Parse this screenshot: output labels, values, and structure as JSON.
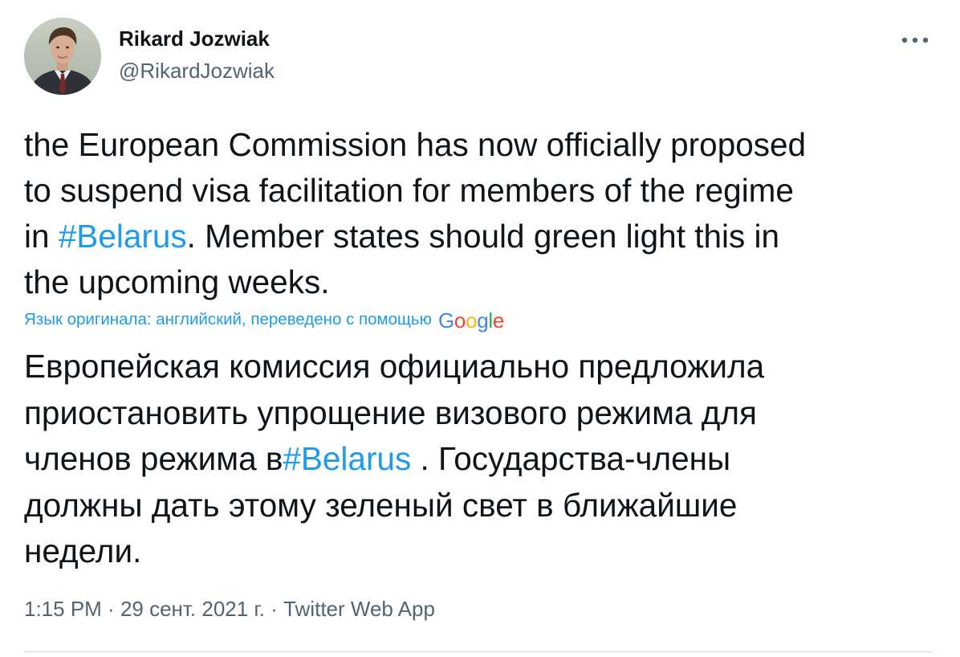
{
  "author": {
    "name": "Rikard Jozwiak",
    "handle": "@RikardJozwiak",
    "avatar_icon": "user-avatar-photo"
  },
  "menu": {
    "more_icon": "more-horizontal-icon"
  },
  "tweet": {
    "lines": [
      {
        "text": "the European Commission has now officially proposed"
      },
      {
        "text": "to suspend visa facilitation for members of the regime"
      },
      {
        "before": "in ",
        "hashtag": "#Belarus",
        "after": ". Member states should green light this in"
      },
      {
        "text": "the upcoming weeks."
      }
    ]
  },
  "translation": {
    "label": "Язык оригинала: английский, переведено с помощью",
    "provider_logo": [
      "G",
      "o",
      "o",
      "g",
      "l",
      "e"
    ],
    "provider_colors": [
      "#4285f4",
      "#ea4335",
      "#fbbc05",
      "#4285f4",
      "#34a853",
      "#ea4335"
    ],
    "lines": [
      {
        "text": "Европейская комиссия официально предложила"
      },
      {
        "text": "приостановить упрощение визового режима для"
      },
      {
        "before": "членов режима в",
        "hashtag": "#Belarus",
        "after": " . Государства-члены"
      },
      {
        "text": "должны дать этому зеленый свет в ближайшие"
      },
      {
        "text": "недели."
      }
    ]
  },
  "meta": {
    "time": "1:15 PM",
    "sep1": " · ",
    "date": "29 сент. 2021 г.",
    "sep2": " · ",
    "source": "Twitter Web App"
  },
  "colors": {
    "link": "#1d9bf0",
    "text": "#0f1419",
    "secondary": "#536471",
    "divider": "#cfd9de"
  }
}
